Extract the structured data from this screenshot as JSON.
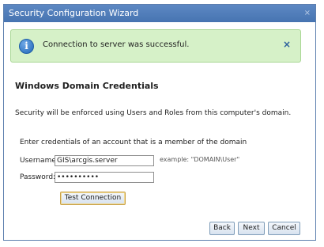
{
  "window": {
    "title": "Security Configuration Wizard",
    "close_glyph": "×"
  },
  "banner": {
    "icon_name": "info-icon",
    "icon_glyph": "i",
    "message": "Connection to server was successful.",
    "close_glyph": "×"
  },
  "section": {
    "title": "Windows Domain Credentials",
    "description": "Security will be enforced using Users and Roles from this computer's domain.",
    "instructions": "Enter credentials of an account that is a member of the domain"
  },
  "form": {
    "username_label": "Username:",
    "username_value": "GIS\\arcgis.server",
    "username_example": "example: \"DOMAIN\\User\"",
    "password_label": "Password:",
    "password_value": "••••••••••"
  },
  "buttons": {
    "test_connection": "Test Connection",
    "back": "Back",
    "next": "Next",
    "cancel": "Cancel"
  },
  "colors": {
    "titlebar": "#4f7cb9",
    "banner_bg": "#d6f1c8",
    "banner_border": "#a9d795"
  }
}
